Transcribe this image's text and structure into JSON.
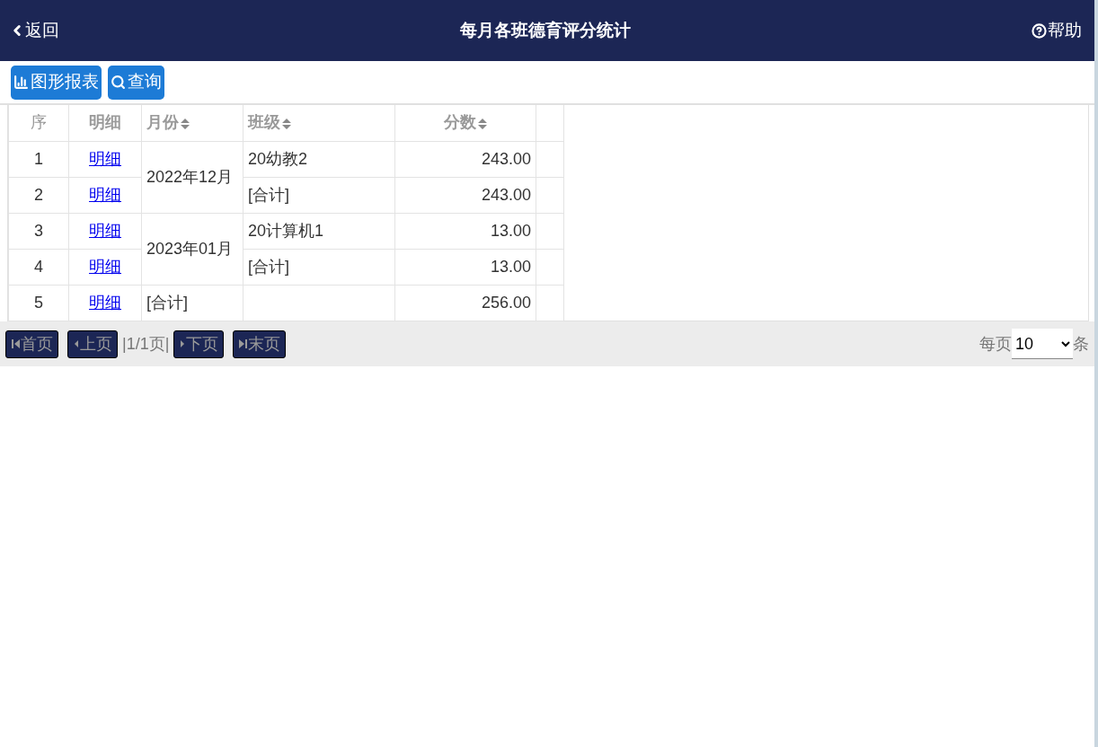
{
  "header": {
    "back": "返回",
    "title": "每月各班德育评分统计",
    "help": "帮助"
  },
  "toolbar": [
    {
      "kind": "chart",
      "label": "图形报表"
    },
    {
      "kind": "search",
      "label": "查询"
    }
  ],
  "table": {
    "columns": [
      {
        "label": "序",
        "sortable": false,
        "bold": false
      },
      {
        "label": "明细",
        "sortable": false,
        "bold": true
      },
      {
        "label": "月份",
        "sortable": true,
        "bold": true
      },
      {
        "label": "班级",
        "sortable": true,
        "bold": true
      },
      {
        "label": "分数",
        "sortable": true,
        "bold": true
      }
    ],
    "groups": [
      {
        "month": "2022年12月",
        "rows": [
          {
            "index": "1",
            "detail": "明细",
            "class": "20幼教2",
            "score": "243.00"
          },
          {
            "index": "2",
            "detail": "明细",
            "class": "[合计]",
            "score": "243.00"
          }
        ]
      },
      {
        "month": "2023年01月",
        "rows": [
          {
            "index": "3",
            "detail": "明细",
            "class": "20计算机1",
            "score": "13.00"
          },
          {
            "index": "4",
            "detail": "明细",
            "class": "[合计]",
            "score": "13.00"
          }
        ]
      },
      {
        "month": "[合计]",
        "rows": [
          {
            "index": "5",
            "detail": "明细",
            "score": "256.00"
          }
        ]
      }
    ]
  },
  "pager": {
    "first": "首页",
    "prev": "上页",
    "info": "|1/1页|",
    "next": "下页",
    "last": "末页",
    "per_page_label": "每页",
    "per_page": "10",
    "unit": "条"
  }
}
